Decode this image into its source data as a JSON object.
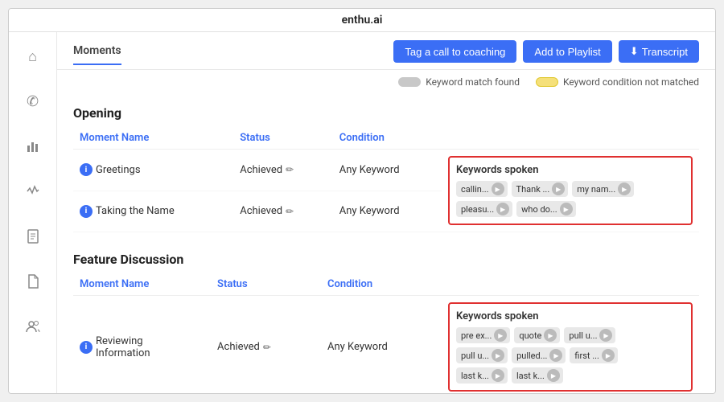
{
  "app": {
    "title": "enthu.ai"
  },
  "sidebar": {
    "icons": [
      {
        "name": "home-icon",
        "glyph": "⌂"
      },
      {
        "name": "phone-icon",
        "glyph": "✆"
      },
      {
        "name": "chart-icon",
        "glyph": "▐"
      },
      {
        "name": "activity-icon",
        "glyph": "⚡"
      },
      {
        "name": "document-icon",
        "glyph": "☰"
      },
      {
        "name": "file-icon",
        "glyph": "📄"
      },
      {
        "name": "users-icon",
        "glyph": "👥"
      }
    ]
  },
  "header": {
    "tab_label": "Moments",
    "btn_coaching": "Tag a call to coaching",
    "btn_playlist": "Add to Playlist",
    "btn_transcript": "Transcript"
  },
  "legend": {
    "match_label": "Keyword match found",
    "not_matched_label": "Keyword condition not matched"
  },
  "sections": [
    {
      "title": "Opening",
      "columns": [
        "Moment Name",
        "Status",
        "Condition",
        "Keywords spoken"
      ],
      "rows": [
        {
          "moment": "Greetings",
          "status": "Achieved",
          "condition": "Any Keyword",
          "keywords": [
            "callin...",
            "Thank ...",
            "my nam...",
            "pleasu...",
            "who do..."
          ]
        },
        {
          "moment": "Taking the Name",
          "status": "Achieved",
          "condition": "Any Keyword",
          "keywords": [
            "pleasu...",
            "who do..."
          ]
        }
      ]
    },
    {
      "title": "Feature Discussion",
      "columns": [
        "Moment Name",
        "Status",
        "Condition",
        "Keywords spoken"
      ],
      "rows": [
        {
          "moment": "Reviewing Information",
          "status": "Achieved",
          "condition": "Any Keyword",
          "keywords": [
            "pre ex...",
            "quote",
            "pull u...",
            "pull u...",
            "pulled...",
            "first ...",
            "last k...",
            "last k..."
          ]
        }
      ]
    }
  ]
}
